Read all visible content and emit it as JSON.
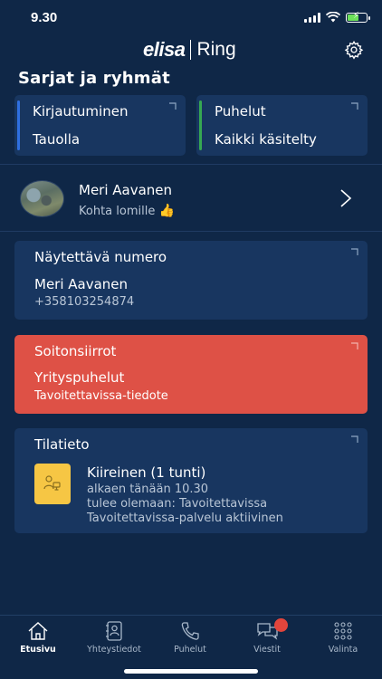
{
  "status_bar": {
    "time": "9.30"
  },
  "header": {
    "brand": "elisa",
    "product": "Ring",
    "settings_icon": "gear-icon"
  },
  "groups": {
    "title": "Sarjat ja ryhmät",
    "items": [
      {
        "label": "Kirjautuminen",
        "value": "Tauolla",
        "accent": "#2f6fe0"
      },
      {
        "label": "Puhelut",
        "value": "Kaikki käsitelty",
        "accent": "#36a852"
      }
    ]
  },
  "profile": {
    "name": "Meri Aavanen",
    "status": "Kohta lomille",
    "status_emoji": "👍"
  },
  "display_number": {
    "title": "Näytettävä numero",
    "name": "Meri Aavanen",
    "number": "+358103254874"
  },
  "call_forwarding": {
    "title": "Soitonsiirrot",
    "value": "Yrityspuhelut",
    "detail": "Tavoitettavissa-tiedote",
    "color": "#de5146"
  },
  "status_info": {
    "title": "Tilatieto",
    "state": "Kiireinen (1 tunti)",
    "lines": [
      "alkaen tänään 10.30",
      "tulee olemaan: Tavoitettavissa",
      "Tavoitettavissa-palvelu aktiivinen"
    ],
    "tile_color": "#f6c644"
  },
  "tabs": [
    {
      "label": "Etusivu",
      "icon": "home-icon",
      "active": true
    },
    {
      "label": "Yhteystiedot",
      "icon": "contacts-icon"
    },
    {
      "label": "Puhelut",
      "icon": "phone-icon"
    },
    {
      "label": "Viestit",
      "icon": "messages-icon",
      "has_badge": true
    },
    {
      "label": "Valinta",
      "icon": "dialpad-icon"
    }
  ]
}
